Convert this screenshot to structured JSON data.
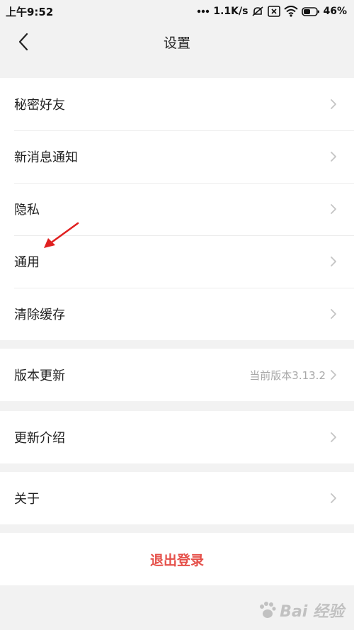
{
  "status_bar": {
    "time": "上午9:52",
    "network_speed": "1.1K/s",
    "battery_percent": "46%",
    "icons": [
      "signal-dots-icon",
      "mute-alarm-icon",
      "sim-x-icon",
      "wifi-icon",
      "battery-icon"
    ]
  },
  "header": {
    "title": "设置",
    "back_icon": "chevron-left-icon"
  },
  "groups": [
    {
      "items": [
        {
          "label": "秘密好友"
        },
        {
          "label": "新消息通知"
        },
        {
          "label": "隐私"
        },
        {
          "label": "通用"
        },
        {
          "label": "清除缓存"
        }
      ]
    },
    {
      "items": [
        {
          "label": "版本更新",
          "value": "当前版本3.13.2"
        }
      ]
    },
    {
      "items": [
        {
          "label": "更新介绍"
        }
      ]
    },
    {
      "items": [
        {
          "label": "关于"
        }
      ]
    }
  ],
  "logout_label": "退出登录",
  "watermark_text": "Bai 经验",
  "colors": {
    "background": "#f2f2f2",
    "logout_red": "#e5504a",
    "chevron_gray": "#c4c4c4",
    "annotation_arrow": "#e02020"
  }
}
